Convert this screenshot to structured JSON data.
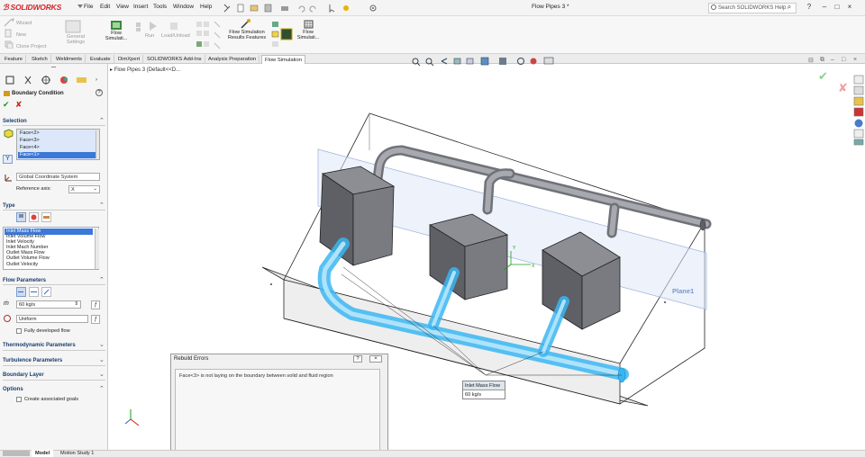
{
  "app": {
    "brand": "SOLIDWORKS",
    "document_title": "Flow Pipes 3 *",
    "search_placeholder": "Search SOLIDWORKS Help",
    "menu": [
      "File",
      "Edit",
      "View",
      "Insert",
      "Tools",
      "Window",
      "Help"
    ]
  },
  "command_manager": {
    "wizard": "Wizard",
    "new": "New",
    "clone_project": "Clone Project",
    "general_settings_1": "General",
    "general_settings_2": "Settings",
    "flow_sim_1": "Flow",
    "flow_sim_2": "Simulati...",
    "run": "Run",
    "load_unload": "Load/Unload",
    "results_features_1": "Flow Simulation",
    "results_features_2": "Results Features",
    "flow_sim_b_1": "Flow",
    "flow_sim_b_2": "Simulati..."
  },
  "tabs": [
    "Feature",
    "Sketch",
    "Weldments",
    "Evaluate",
    "DimXpert",
    "SOLIDWORKS Add-Ins",
    "Analysis Preparation",
    "Flow Simulation"
  ],
  "active_tab": "Flow Simulation",
  "tree_header": "Flow Pipes 3  (Default<<D...",
  "panel": {
    "title": "Boundary Condition",
    "selection_header": "Selection",
    "faces": [
      "Face<2>",
      "Face<3>",
      "Face<4>",
      "Face<1>"
    ],
    "coord_system": "Global Coordinate System",
    "reference_axis_label": "Reference axis:",
    "reference_axis_value": "X",
    "type_header": "Type",
    "types": [
      "Inlet Mass Flow",
      "Inlet Volume Flow",
      "Inlet Velocity",
      "Inlet Mach Number",
      "Outlet Mass Flow",
      "Outlet Volume Flow",
      "Outlet Velocity"
    ],
    "flow_params_header": "Flow Parameters",
    "mass_flow_value": "60 kg/s",
    "profile_value": "Uniform",
    "fully_developed": "Fully developed flow",
    "thermo_header": "Thermodynamic Parameters",
    "turbulence_header": "Turbulence Parameters",
    "boundary_layer_header": "Boundary Layer",
    "options_header": "Options",
    "create_goals": "Create associated goals"
  },
  "viewport": {
    "plane_label": "Plane1",
    "axis_x": "X",
    "axis_y": "Y"
  },
  "callout": {
    "title": "Inlet Mass Flow",
    "value": "60 kg/s"
  },
  "dialog": {
    "title": "Rebuild Errors",
    "message": "Face<3> is not laying on the boundary between solid and fluid region"
  },
  "bottom_tabs": [
    "Model",
    "Motion Study 1"
  ],
  "colors": {
    "brand": "#d2232a",
    "selection": "#3b78d8",
    "highlight_pipe": "#39b6f2"
  }
}
